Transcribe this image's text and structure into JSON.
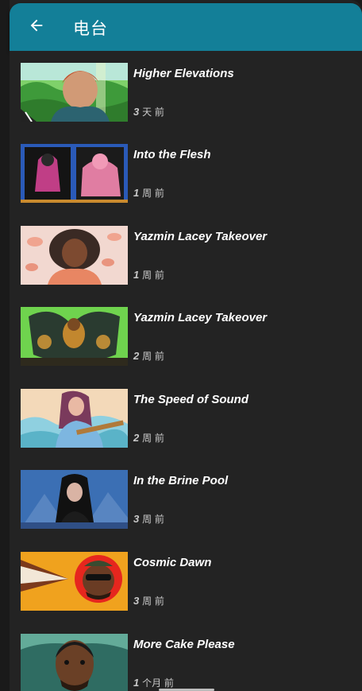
{
  "colors": {
    "accent": "#137f98",
    "background": "#232323"
  },
  "header": {
    "title": "电台",
    "back_icon": "arrow-left-icon"
  },
  "episodes": [
    {
      "title": "Higher Elevations",
      "age_num": "3",
      "age_unit": "天 前"
    },
    {
      "title": "Into the Flesh",
      "age_num": "1",
      "age_unit": "周 前"
    },
    {
      "title": "Yazmin Lacey Takeover",
      "age_num": "1",
      "age_unit": "周 前"
    },
    {
      "title": "Yazmin Lacey Takeover",
      "age_num": "2",
      "age_unit": "周 前"
    },
    {
      "title": "The Speed of Sound",
      "age_num": "2",
      "age_unit": "周 前"
    },
    {
      "title": "In the Brine Pool",
      "age_num": "3",
      "age_unit": "周 前"
    },
    {
      "title": "Cosmic Dawn",
      "age_num": "3",
      "age_unit": "周 前"
    },
    {
      "title": "More Cake Please",
      "age_num": "1",
      "age_unit": "个月 前"
    }
  ]
}
